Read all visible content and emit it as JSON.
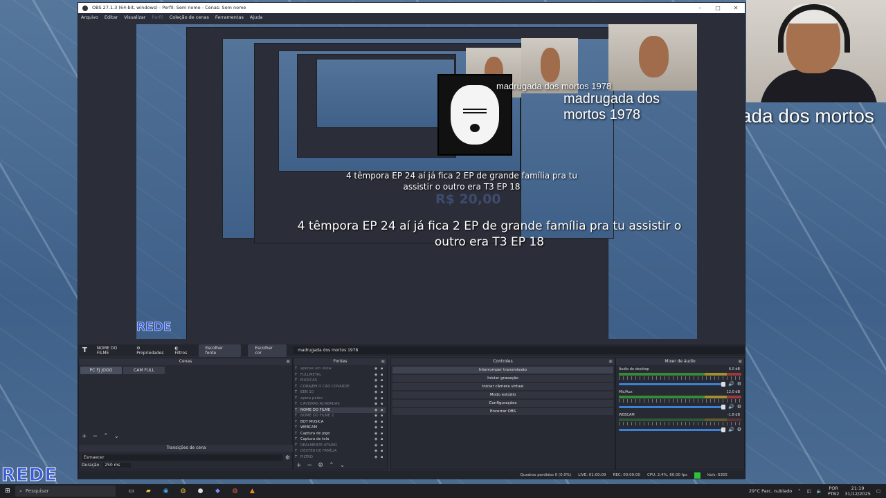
{
  "window": {
    "title": "OBS 27.1.3 (64-bit, windows) - Perfil: Sem nome - Cenas: Sem nome",
    "menus": [
      "Arquivo",
      "Editar",
      "Visualizar",
      "Perfil",
      "Coleção de cenas",
      "Ferramentas",
      "Ajuda"
    ]
  },
  "overlay": {
    "caption": "4 têmpora EP 24 aí já fica 2 EP de grande família pra tu assistir o outro era T3 EP 18",
    "caption_small": "4 têmpora EP 24 aí já fica 2 EP de grande família pra tu assistir o outro era T3 EP 18",
    "price": "R$ 20,00",
    "movie_title": "madrugada dos mortos 1978",
    "logo": "REDE"
  },
  "source_toolbar": {
    "source_name": "NOME DO FILME",
    "properties": "Propriedades",
    "filters": "Filtros",
    "choose_font": "Escolher fonte",
    "choose_color": "Escolher cor",
    "text_value": "madrugada dos mortos 1978"
  },
  "scenes": {
    "title": "Cenas",
    "items": [
      "PC FJ JOGO",
      "CAM FULL"
    ]
  },
  "transitions": {
    "title": "Transições de cena",
    "selected": "Esmaecer",
    "duration_label": "Duração",
    "duration_value": "250 ms"
  },
  "sources": {
    "title": "Fontes",
    "items": [
      {
        "name": "apenas um show",
        "hidden": true
      },
      {
        "name": "FULLMETAL",
        "hidden": true
      },
      {
        "name": "MUSICAS",
        "hidden": true
      },
      {
        "name": "CORAJEM O CÃO COVARDE",
        "hidden": true
      },
      {
        "name": "EEN 10",
        "hidden": true
      },
      {
        "name": "apera pedro",
        "hidden": true
      },
      {
        "name": "CAVEIRAS ACABADAS",
        "hidden": true
      },
      {
        "name": "NOME DO FILME",
        "hidden": false,
        "selected": true
      },
      {
        "name": "NOME DO FILME 2",
        "hidden": true
      },
      {
        "name": "BOT MUSICA",
        "hidden": false
      },
      {
        "name": "WEBCAM",
        "hidden": false
      },
      {
        "name": "Captura de jogo",
        "hidden": false
      },
      {
        "name": "Captura de tela",
        "hidden": false
      },
      {
        "name": "REALMENTE ATIVÃO",
        "hidden": true
      },
      {
        "name": "DEXTER DE FAMÍLIA",
        "hidden": true
      },
      {
        "name": "FILTRO",
        "hidden": true
      }
    ]
  },
  "controls": {
    "title": "Controles",
    "buttons": [
      "Interromper transmissão",
      "Iniciar gravação",
      "Iniciar câmera virtual",
      "Modo estúdio",
      "Configurações",
      "Encerrar OBS"
    ]
  },
  "mixer": {
    "title": "Mixer de áudio",
    "channels": [
      {
        "name": "Áudio do desktop",
        "db": "6.0 dB"
      },
      {
        "name": "Mic/Aux",
        "db": "12.0 dB"
      },
      {
        "name": "WEBCAM",
        "db": "-1.8 dB"
      }
    ]
  },
  "status": {
    "dropped": "Quadros perdidos 0 (0.0%)",
    "live": "LIVE: 01:00:09",
    "rec": "REC: 00:00:00",
    "cpu": "CPU: 2.4%, 60.00 fps",
    "kbps": "kb/s: 6355"
  },
  "taskbar": {
    "search_placeholder": "Pesquisar",
    "weather": "29°C  Parc. nublado",
    "lang_top": "POR",
    "lang_bottom": "PTB2",
    "time": "21:19",
    "date": "31/12/2025"
  },
  "colors": {
    "obs_bg": "#2b2e38",
    "accent_blue": "#3b82d6",
    "live_green": "#2ec13a"
  }
}
